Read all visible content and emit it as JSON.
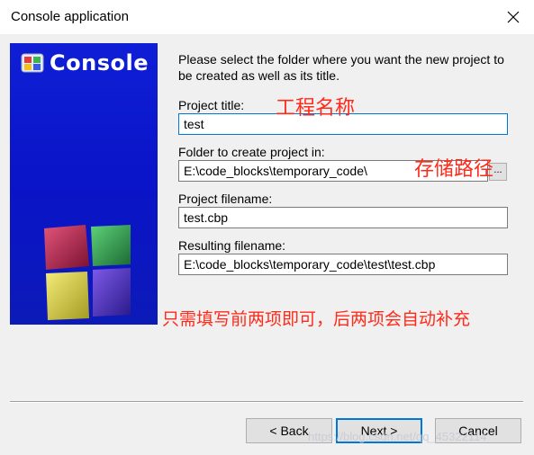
{
  "window": {
    "title": "Console application",
    "close_icon": "close-icon"
  },
  "side_panel": {
    "logo_text": "Console",
    "logo_icon": "codeblocks-logo-icon",
    "cubes_icon": "cubes-icon"
  },
  "intro_text": "Please select the folder where you want the new project to be created as well as its title.",
  "fields": {
    "project_title": {
      "label": "Project title:",
      "value": "test"
    },
    "folder": {
      "label": "Folder to create project in:",
      "value": "E:\\code_blocks\\temporary_code\\",
      "browse_label": "..."
    },
    "project_filename": {
      "label": "Project filename:",
      "value": "test.cbp"
    },
    "resulting_filename": {
      "label": "Resulting filename:",
      "value": "E:\\code_blocks\\temporary_code\\test\\test.cbp"
    }
  },
  "annotations": {
    "project_name": "工程名称",
    "storage_path": "存储路径",
    "note": "只需填写前两项即可，后两项会自动补充"
  },
  "buttons": {
    "back": "< Back",
    "next": "Next >",
    "cancel": "Cancel"
  },
  "watermark": "https://blog.csdn.net/qq_45322114",
  "colors": {
    "panel_blue": "#0f1fd6",
    "annotation_red": "#ff2a1a",
    "focus_blue": "#0078d7"
  }
}
